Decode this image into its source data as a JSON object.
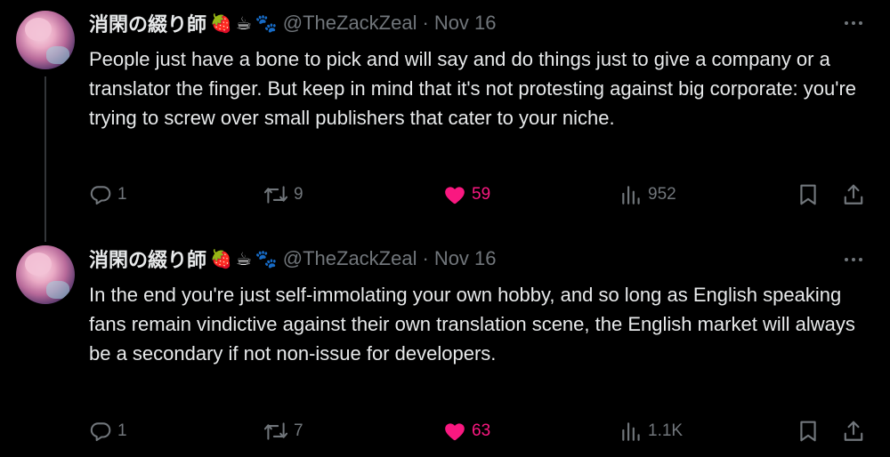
{
  "tweets": [
    {
      "name": "消閑の綴り師",
      "emojis": [
        "🍓",
        "☕",
        "🐾"
      ],
      "handle": "@TheZackZeal",
      "separator": "·",
      "date": "Nov 16",
      "text": "People just have a bone to pick and will say and do things just to give a company or a translator the finger. But keep in mind that it's not protesting against big corporate: you're trying to screw over small publishers that cater to your niche.",
      "replies": "1",
      "reposts": "9",
      "likes": "59",
      "views": "952"
    },
    {
      "name": "消閑の綴り師",
      "emojis": [
        "🍓",
        "☕",
        "🐾"
      ],
      "handle": "@TheZackZeal",
      "separator": "·",
      "date": "Nov 16",
      "text": "In the end you're just self-immolating your own hobby, and so long as English speaking fans remain vindictive against their own translation scene, the English market will always be a secondary if not non-issue for developers.",
      "replies": "1",
      "reposts": "7",
      "likes": "63",
      "views": "1.1K"
    }
  ],
  "colors": {
    "background": "#000000",
    "text": "#e7e9ea",
    "muted": "#71767b",
    "like": "#f91880",
    "thread_line": "#333639"
  },
  "icons": [
    "reply-icon",
    "repost-icon",
    "like-icon",
    "views-icon",
    "bookmark-icon",
    "share-icon",
    "more-icon"
  ]
}
